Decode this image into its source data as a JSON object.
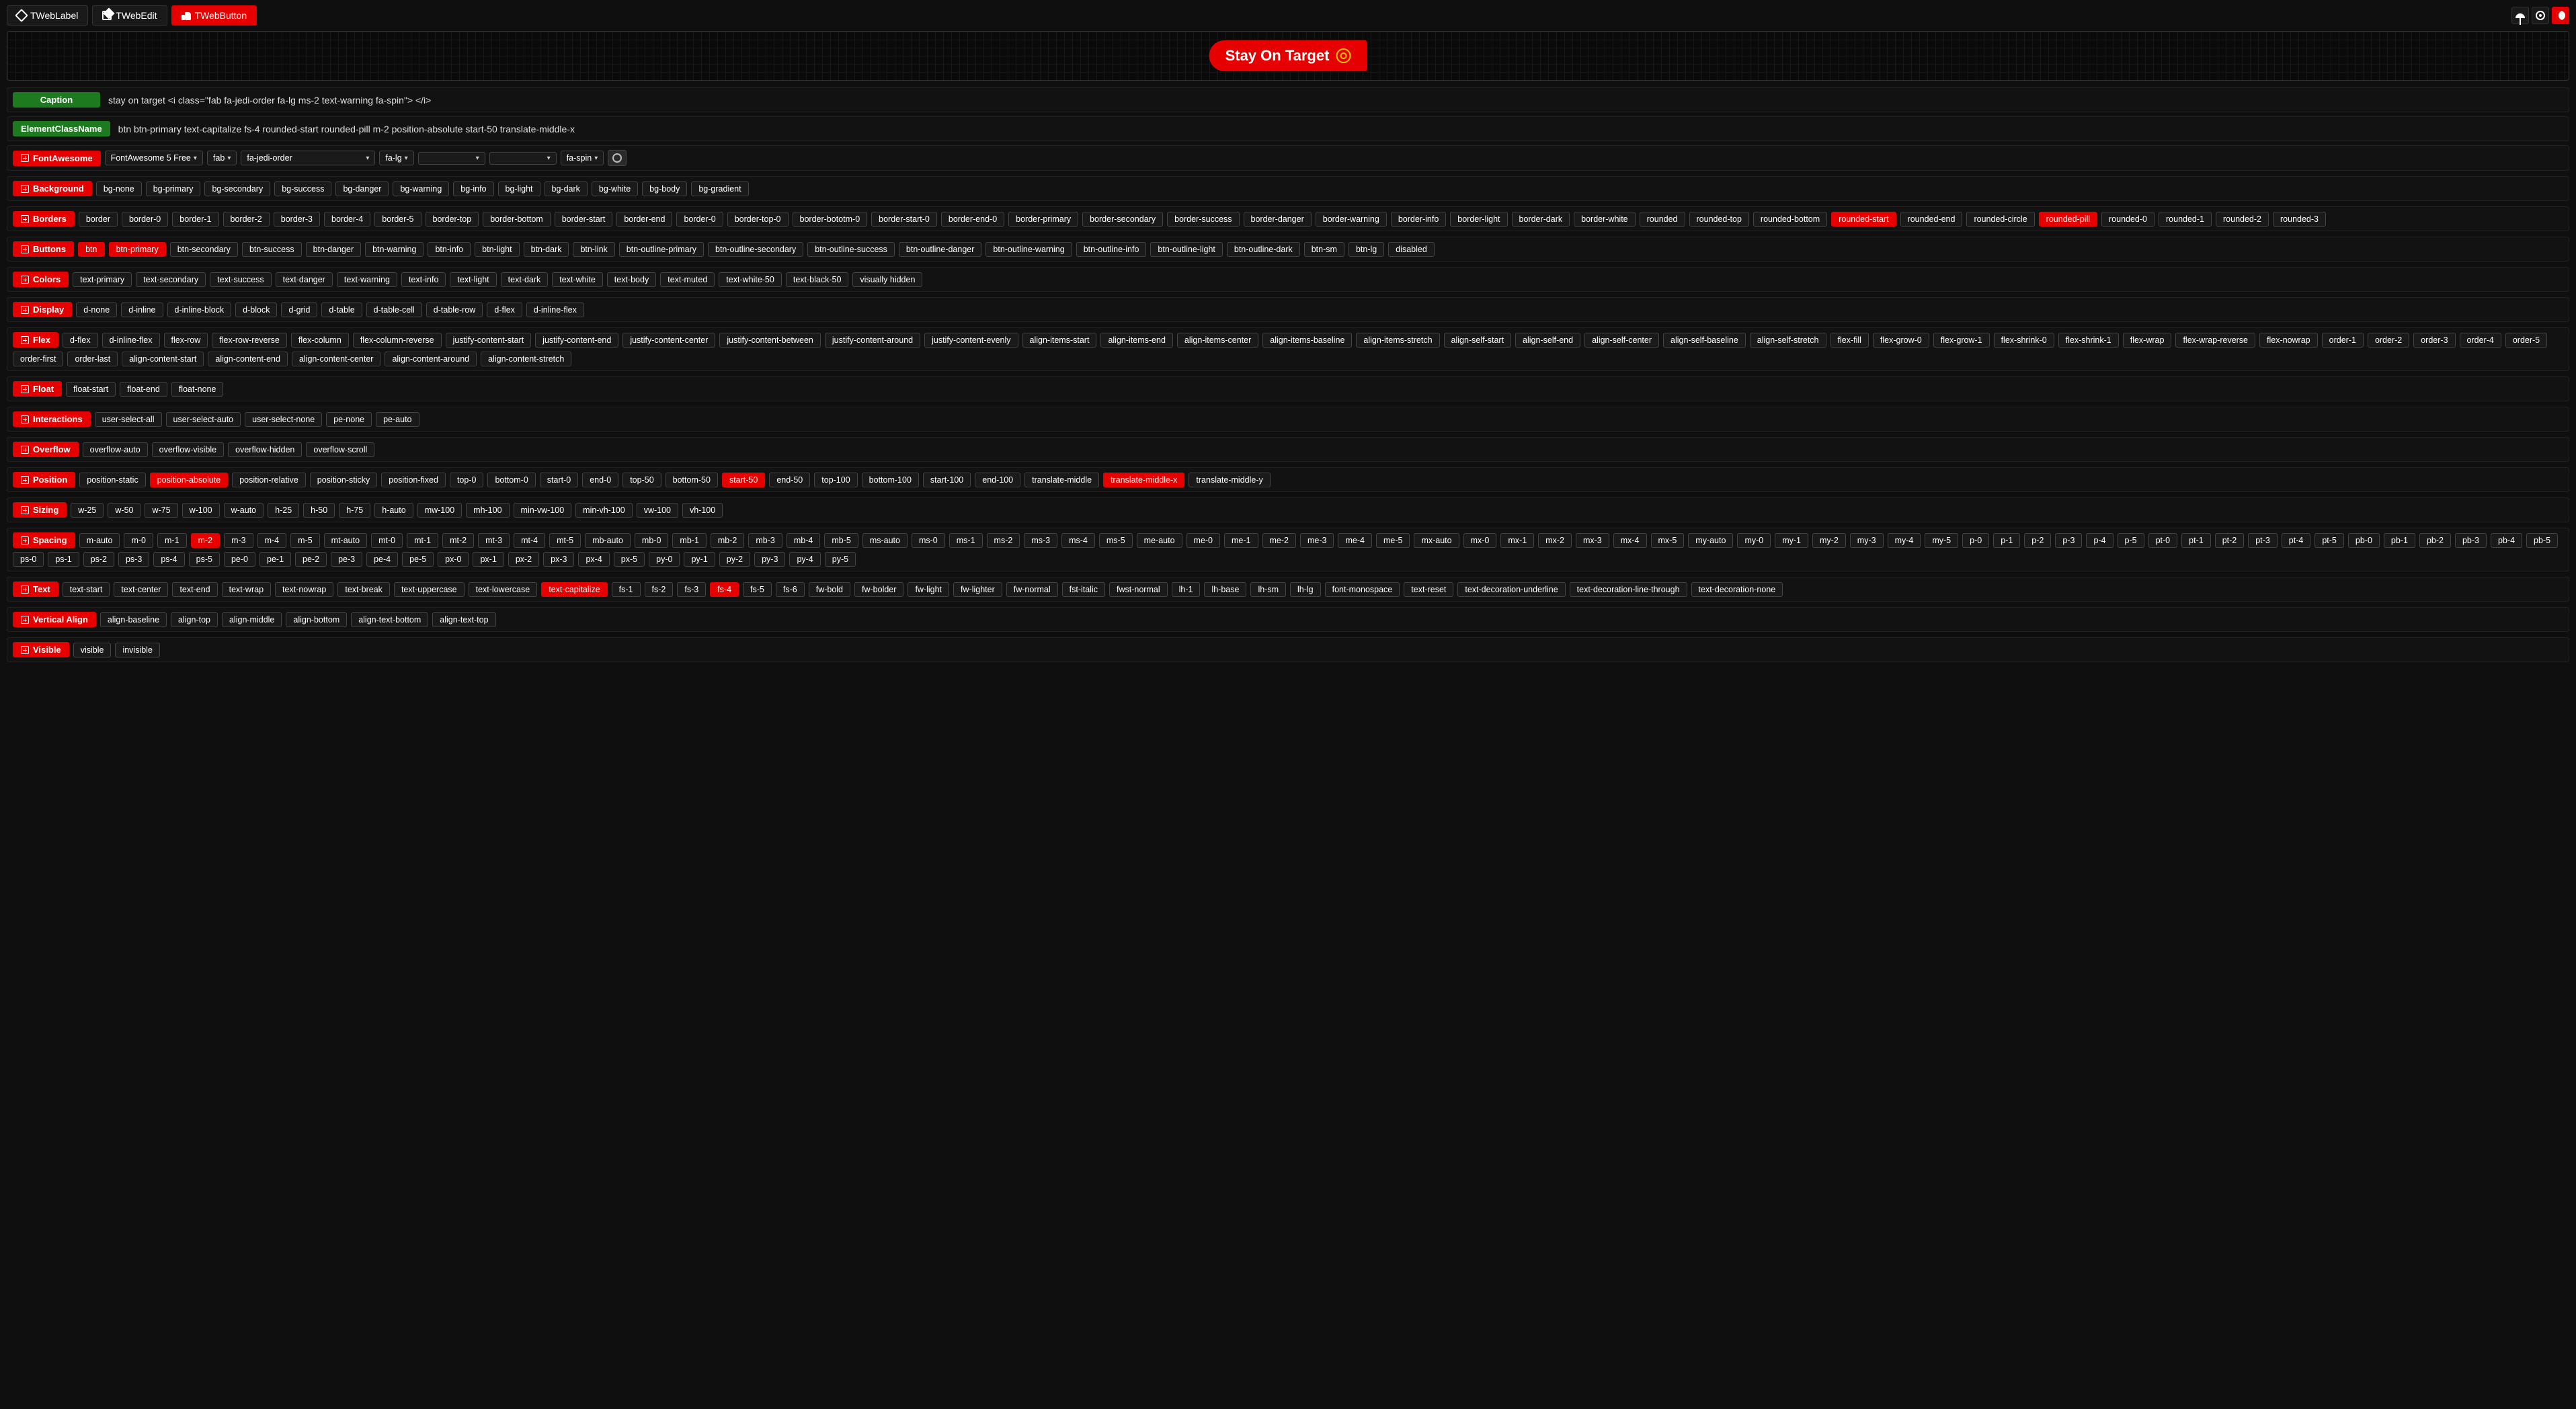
{
  "tabs": [
    {
      "label": "TWebLabel",
      "active": false
    },
    {
      "label": "TWebEdit",
      "active": false
    },
    {
      "label": "TWebButton",
      "active": true
    }
  ],
  "preview_button_text": "Stay On Target",
  "props": {
    "caption_label": "Caption",
    "caption_value": "stay on target <i class=\"fab fa-jedi-order fa-lg ms-2 text-warning fa-spin\"> </i>",
    "ecn_label": "ElementClassName",
    "ecn_value": "btn btn-primary text-capitalize fs-4 rounded-start rounded-pill m-2 position-absolute start-50 translate-middle-x"
  },
  "fontawesome": {
    "header": "FontAwesome",
    "family": "FontAwesome 5 Free",
    "variant": "fab",
    "icon": "fa-jedi-order",
    "size": "fa-lg",
    "extra1": "",
    "extra2": "",
    "spin": "fa-spin"
  },
  "sections": [
    {
      "name": "Background",
      "selected": [],
      "options": [
        "bg-none",
        "bg-primary",
        "bg-secondary",
        "bg-success",
        "bg-danger",
        "bg-warning",
        "bg-info",
        "bg-light",
        "bg-dark",
        "bg-white",
        "bg-body",
        "bg-gradient"
      ]
    },
    {
      "name": "Borders",
      "selected": [
        "rounded-start",
        "rounded-pill"
      ],
      "options": [
        "border",
        "border-0",
        "border-1",
        "border-2",
        "border-3",
        "border-4",
        "border-5",
        "border-top",
        "border-bottom",
        "border-start",
        "border-end",
        "border-0",
        "border-top-0",
        "border-bototm-0",
        "border-start-0",
        "border-end-0",
        "border-primary",
        "border-secondary",
        "border-success",
        "border-danger",
        "border-warning",
        "border-info",
        "border-light",
        "border-dark",
        "border-white",
        "rounded",
        "rounded-top",
        "rounded-bottom",
        "rounded-start",
        "rounded-end",
        "rounded-circle",
        "rounded-pill",
        "rounded-0",
        "rounded-1",
        "rounded-2",
        "rounded-3"
      ]
    },
    {
      "name": "Buttons",
      "selected": [
        "btn",
        "btn-primary"
      ],
      "options": [
        "btn",
        "btn-primary",
        "btn-secondary",
        "btn-success",
        "btn-danger",
        "btn-warning",
        "btn-info",
        "btn-light",
        "btn-dark",
        "btn-link",
        "btn-outline-primary",
        "btn-outline-secondary",
        "btn-outline-success",
        "btn-outline-danger",
        "btn-outline-warning",
        "btn-outline-info",
        "btn-outline-light",
        "btn-outline-dark",
        "btn-sm",
        "btn-lg",
        "disabled"
      ]
    },
    {
      "name": "Colors",
      "selected": [],
      "options": [
        "text-primary",
        "text-secondary",
        "text-success",
        "text-danger",
        "text-warning",
        "text-info",
        "text-light",
        "text-dark",
        "text-white",
        "text-body",
        "text-muted",
        "text-white-50",
        "text-black-50",
        "visually hidden"
      ]
    },
    {
      "name": "Display",
      "selected": [],
      "options": [
        "d-none",
        "d-inline",
        "d-inline-block",
        "d-block",
        "d-grid",
        "d-table",
        "d-table-cell",
        "d-table-row",
        "d-flex",
        "d-inline-flex"
      ]
    },
    {
      "name": "Flex",
      "selected": [],
      "options": [
        "d-flex",
        "d-inline-flex",
        "flex-row",
        "flex-row-reverse",
        "flex-column",
        "flex-column-reverse",
        "justify-content-start",
        "justify-content-end",
        "justify-content-center",
        "justify-content-between",
        "justify-content-around",
        "justify-content-evenly",
        "align-items-start",
        "align-items-end",
        "align-items-center",
        "align-items-baseline",
        "align-items-stretch",
        "align-self-start",
        "align-self-end",
        "align-self-center",
        "align-self-baseline",
        "align-self-stretch",
        "flex-fill",
        "flex-grow-0",
        "flex-grow-1",
        "flex-shrink-0",
        "flex-shrink-1",
        "flex-wrap",
        "flex-wrap-reverse",
        "flex-nowrap",
        "order-1",
        "order-2",
        "order-3",
        "order-4",
        "order-5",
        "order-first",
        "order-last",
        "align-content-start",
        "align-content-end",
        "align-content-center",
        "align-content-around",
        "align-content-stretch"
      ]
    },
    {
      "name": "Float",
      "selected": [],
      "options": [
        "float-start",
        "float-end",
        "float-none"
      ]
    },
    {
      "name": "Interactions",
      "selected": [],
      "options": [
        "user-select-all",
        "user-select-auto",
        "user-select-none",
        "pe-none",
        "pe-auto"
      ]
    },
    {
      "name": "Overflow",
      "selected": [],
      "options": [
        "overflow-auto",
        "overflow-visible",
        "overflow-hidden",
        "overflow-scroll"
      ]
    },
    {
      "name": "Position",
      "selected": [
        "position-absolute",
        "start-50",
        "translate-middle-x"
      ],
      "options": [
        "position-static",
        "position-absolute",
        "position-relative",
        "position-sticky",
        "position-fixed",
        "top-0",
        "bottom-0",
        "start-0",
        "end-0",
        "top-50",
        "bottom-50",
        "start-50",
        "end-50",
        "top-100",
        "bottom-100",
        "start-100",
        "end-100",
        "translate-middle",
        "translate-middle-x",
        "translate-middle-y"
      ]
    },
    {
      "name": "Sizing",
      "selected": [],
      "options": [
        "w-25",
        "w-50",
        "w-75",
        "w-100",
        "w-auto",
        "h-25",
        "h-50",
        "h-75",
        "h-auto",
        "mw-100",
        "mh-100",
        "min-vw-100",
        "min-vh-100",
        "vw-100",
        "vh-100"
      ]
    },
    {
      "name": "Spacing",
      "selected": [
        "m-2"
      ],
      "options": [
        "m-auto",
        "m-0",
        "m-1",
        "m-2",
        "m-3",
        "m-4",
        "m-5",
        "mt-auto",
        "mt-0",
        "mt-1",
        "mt-2",
        "mt-3",
        "mt-4",
        "mt-5",
        "mb-auto",
        "mb-0",
        "mb-1",
        "mb-2",
        "mb-3",
        "mb-4",
        "mb-5",
        "ms-auto",
        "ms-0",
        "ms-1",
        "ms-2",
        "ms-3",
        "ms-4",
        "ms-5",
        "me-auto",
        "me-0",
        "me-1",
        "me-2",
        "me-3",
        "me-4",
        "me-5",
        "mx-auto",
        "mx-0",
        "mx-1",
        "mx-2",
        "mx-3",
        "mx-4",
        "mx-5",
        "my-auto",
        "my-0",
        "my-1",
        "my-2",
        "my-3",
        "my-4",
        "my-5",
        "p-0",
        "p-1",
        "p-2",
        "p-3",
        "p-4",
        "p-5",
        "pt-0",
        "pt-1",
        "pt-2",
        "pt-3",
        "pt-4",
        "pt-5",
        "pb-0",
        "pb-1",
        "pb-2",
        "pb-3",
        "pb-4",
        "pb-5",
        "ps-0",
        "ps-1",
        "ps-2",
        "ps-3",
        "ps-4",
        "ps-5",
        "pe-0",
        "pe-1",
        "pe-2",
        "pe-3",
        "pe-4",
        "pe-5",
        "px-0",
        "px-1",
        "px-2",
        "px-3",
        "px-4",
        "px-5",
        "py-0",
        "py-1",
        "py-2",
        "py-3",
        "py-4",
        "py-5"
      ]
    },
    {
      "name": "Text",
      "selected": [
        "text-capitalize",
        "fs-4"
      ],
      "options": [
        "text-start",
        "text-center",
        "text-end",
        "text-wrap",
        "text-nowrap",
        "text-break",
        "text-uppercase",
        "text-lowercase",
        "text-capitalize",
        "fs-1",
        "fs-2",
        "fs-3",
        "fs-4",
        "fs-5",
        "fs-6",
        "fw-bold",
        "fw-bolder",
        "fw-light",
        "fw-lighter",
        "fw-normal",
        "fst-italic",
        "fwst-normal",
        "lh-1",
        "lh-base",
        "lh-sm",
        "lh-lg",
        "font-monospace",
        "text-reset",
        "text-decoration-underline",
        "text-decoration-line-through",
        "text-decoration-none"
      ]
    },
    {
      "name": "Vertical Align",
      "selected": [],
      "options": [
        "align-baseline",
        "align-top",
        "align-middle",
        "align-bottom",
        "align-text-bottom",
        "align-text-top"
      ]
    },
    {
      "name": "Visible",
      "selected": [],
      "options": [
        "visible",
        "invisible"
      ]
    }
  ]
}
